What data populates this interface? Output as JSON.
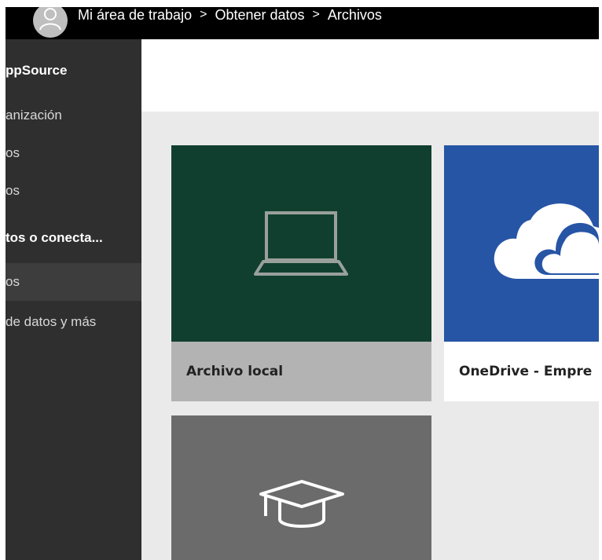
{
  "breadcrumb": {
    "items": [
      "Mi área de trabajo",
      "Obtener datos",
      "Archivos"
    ],
    "separator": ">"
  },
  "sidebar": {
    "items": [
      {
        "label": "ppSource"
      },
      {
        "label": "anización"
      },
      {
        "label": "os"
      },
      {
        "label": "os"
      },
      {
        "label": "tos o conecta..."
      },
      {
        "label": "os"
      },
      {
        "label": "de datos y más"
      }
    ]
  },
  "tiles": [
    {
      "label": "Archivo local",
      "color": "#113f2f",
      "caption_bg": "#b3b3b3",
      "icon": "laptop-icon"
    },
    {
      "label": "OneDrive - Empre",
      "color": "#2755a5",
      "caption_bg": "#ffffff",
      "icon": "cloud-icon"
    },
    {
      "label": "",
      "color": "#6b6b6b",
      "caption_bg": "#6b6b6b",
      "icon": "graduation-cap-icon"
    }
  ],
  "colors": {
    "topbar": "#000000",
    "sidebar": "#2f2f2f",
    "content_bg": "#eaeaea"
  }
}
